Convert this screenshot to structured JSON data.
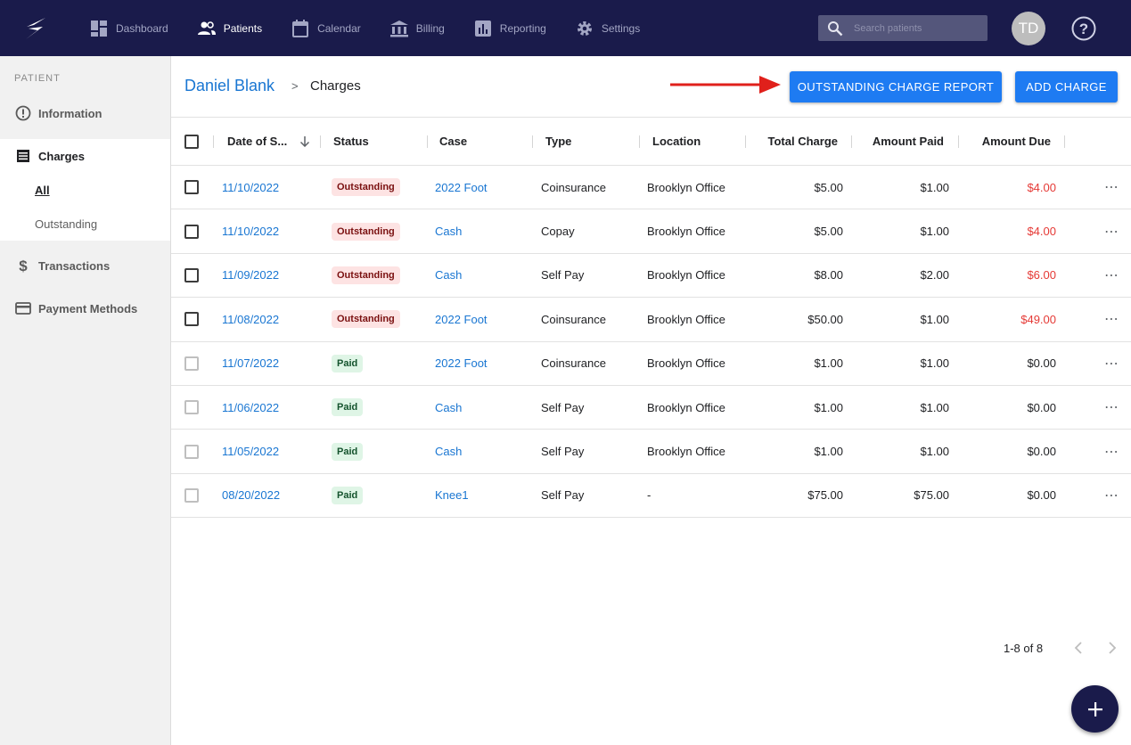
{
  "nav": {
    "items": [
      {
        "label": "Dashboard",
        "icon": "dashboard-icon"
      },
      {
        "label": "Patients",
        "icon": "people-icon"
      },
      {
        "label": "Calendar",
        "icon": "calendar-icon"
      },
      {
        "label": "Billing",
        "icon": "bank-icon"
      },
      {
        "label": "Reporting",
        "icon": "bar-chart-icon"
      },
      {
        "label": "Settings",
        "icon": "gear-icon"
      }
    ],
    "active": "Patients",
    "search_placeholder": "Search patients",
    "avatar_initials": "TD"
  },
  "sidebar": {
    "heading": "PATIENT",
    "information": "Information",
    "charges": "Charges",
    "sub_all": "All",
    "sub_outstanding": "Outstanding",
    "transactions": "Transactions",
    "payment_methods": "Payment Methods"
  },
  "header": {
    "patient_name": "Daniel Blank",
    "separator": ">",
    "page": "Charges",
    "report_button": "OUTSTANDING CHARGE REPORT",
    "add_button": "ADD CHARGE"
  },
  "table": {
    "columns": {
      "date": "Date of S...",
      "status": "Status",
      "case": "Case",
      "type": "Type",
      "location": "Location",
      "total": "Total Charge",
      "paid": "Amount Paid",
      "due": "Amount Due"
    },
    "rows": [
      {
        "date": "11/10/2022",
        "status": "Outstanding",
        "case": "2022 Foot",
        "type": "Coinsurance",
        "location": "Brooklyn Office",
        "total": "$5.00",
        "paid": "$1.00",
        "due": "$4.00"
      },
      {
        "date": "11/10/2022",
        "status": "Outstanding",
        "case": "Cash",
        "type": "Copay",
        "location": "Brooklyn Office",
        "total": "$5.00",
        "paid": "$1.00",
        "due": "$4.00"
      },
      {
        "date": "11/09/2022",
        "status": "Outstanding",
        "case": "Cash",
        "type": "Self Pay",
        "location": "Brooklyn Office",
        "total": "$8.00",
        "paid": "$2.00",
        "due": "$6.00"
      },
      {
        "date": "11/08/2022",
        "status": "Outstanding",
        "case": "2022 Foot",
        "type": "Coinsurance",
        "location": "Brooklyn Office",
        "total": "$50.00",
        "paid": "$1.00",
        "due": "$49.00"
      },
      {
        "date": "11/07/2022",
        "status": "Paid",
        "case": "2022 Foot",
        "type": "Coinsurance",
        "location": "Brooklyn Office",
        "total": "$1.00",
        "paid": "$1.00",
        "due": "$0.00"
      },
      {
        "date": "11/06/2022",
        "status": "Paid",
        "case": "Cash",
        "type": "Self Pay",
        "location": "Brooklyn Office",
        "total": "$1.00",
        "paid": "$1.00",
        "due": "$0.00"
      },
      {
        "date": "11/05/2022",
        "status": "Paid",
        "case": "Cash",
        "type": "Self Pay",
        "location": "Brooklyn Office",
        "total": "$1.00",
        "paid": "$1.00",
        "due": "$0.00"
      },
      {
        "date": "08/20/2022",
        "status": "Paid",
        "case": "Knee1",
        "type": "Self Pay",
        "location": "-",
        "total": "$75.00",
        "paid": "$75.00",
        "due": "$0.00"
      }
    ]
  },
  "pagination": {
    "text": "1-8 of 8"
  },
  "colors": {
    "nav_bg": "#1a1b4b",
    "accent": "#1e7bf2",
    "link": "#1976d2",
    "due_red": "#e53935",
    "annotation_arrow": "#e0201b"
  }
}
